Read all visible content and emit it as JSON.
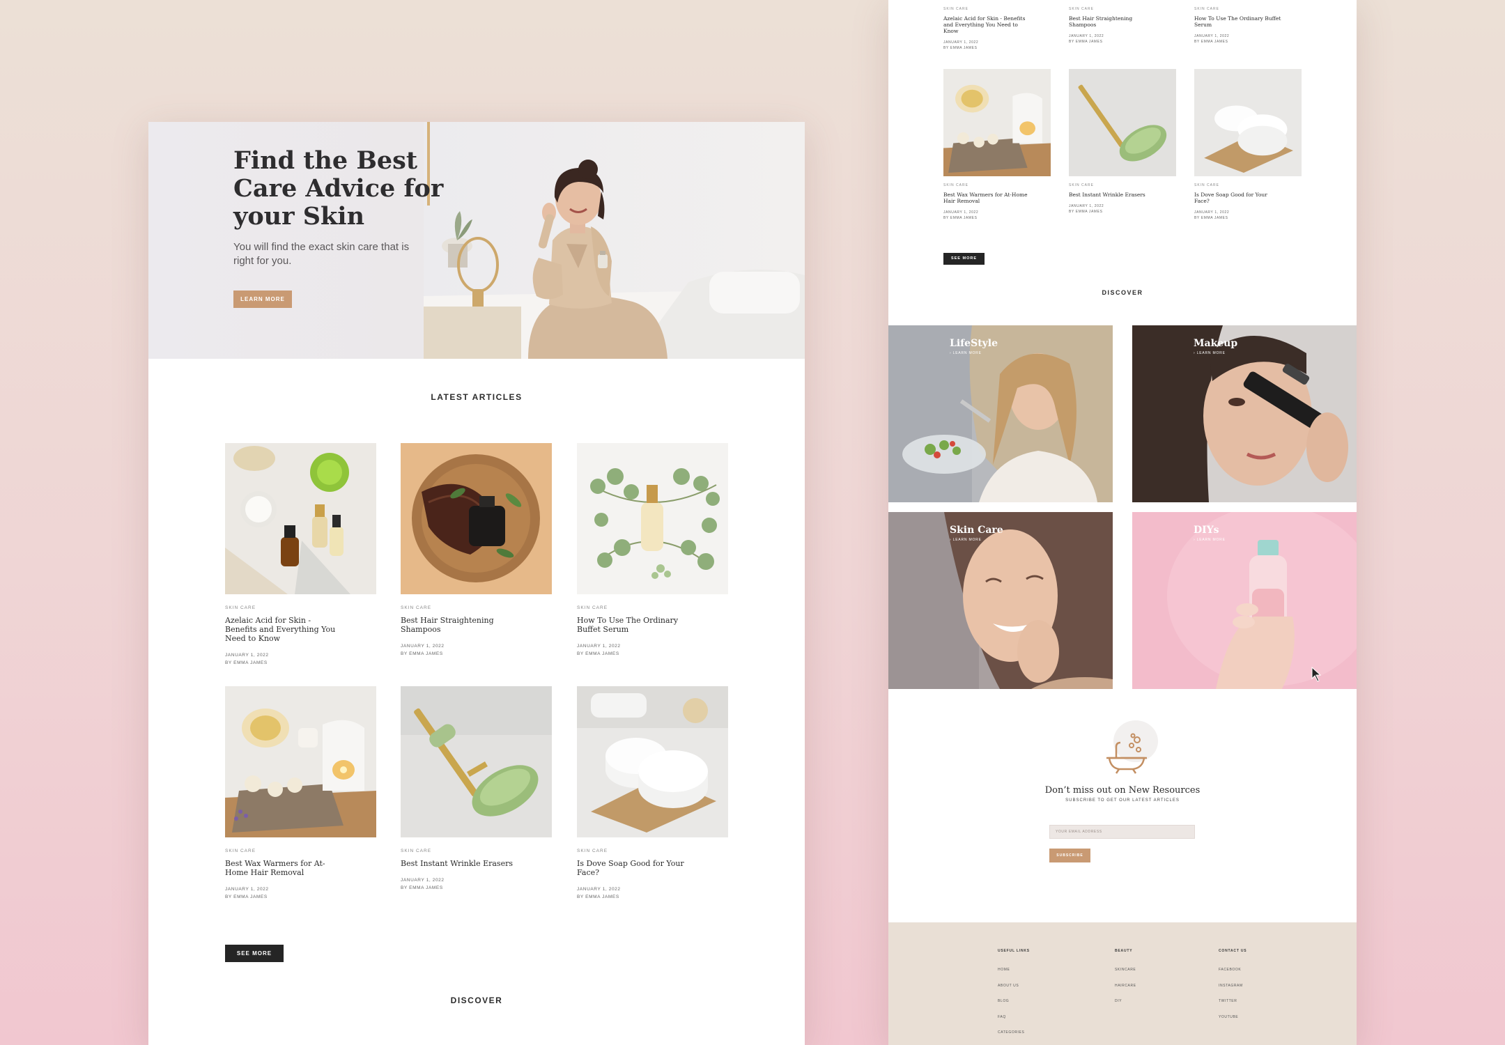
{
  "hero": {
    "title": "Find the Best Care Advice for your Skin",
    "subtitle": "You will find the exact skin care that is right for you.",
    "button_label": "LEARN MORE"
  },
  "latest": {
    "heading": "LATEST ARTICLES"
  },
  "articles": [
    {
      "category": "SKIN CARE",
      "title": "Azelaic Acid for Skin - Benefits and Everything You Need to Know",
      "date": "JANUARY 1, 2022",
      "author": "BY EMMA JAMES"
    },
    {
      "category": "SKIN CARE",
      "title": "Best Hair Straightening Shampoos",
      "date": "JANUARY 1, 2022",
      "author": "BY EMMA JAMES"
    },
    {
      "category": "SKIN CARE",
      "title": "How To Use The Ordinary Buffet Serum",
      "date": "JANUARY 1, 2022",
      "author": "BY EMMA JAMES"
    },
    {
      "category": "SKIN CARE",
      "title": "Best Wax Warmers for At-Home Hair Removal",
      "date": "JANUARY 1, 2022",
      "author": "BY EMMA JAMES"
    },
    {
      "category": "SKIN CARE",
      "title": "Best Instant Wrinkle Erasers",
      "date": "JANUARY 1, 2022",
      "author": "BY EMMA JAMES"
    },
    {
      "category": "SKIN CARE",
      "title": "Is Dove Soap Good for Your Face?",
      "date": "JANUARY 1, 2022",
      "author": "BY EMMA JAMES"
    }
  ],
  "see_more_label": "SEE MORE",
  "discover": {
    "heading": "DISCOVER",
    "tiles": [
      {
        "title": "LifeStyle",
        "link": "› LEARN MORE"
      },
      {
        "title": "Makeup",
        "link": "› LEARN MORE"
      },
      {
        "title": "Skin Care",
        "link": "› LEARN MORE"
      },
      {
        "title": "DIYs",
        "link": "› LEARN MORE"
      }
    ]
  },
  "newsletter": {
    "title": "Don’t miss out on New Resources",
    "subtitle": "SUBSCRIBE TO GET OUR LATEST ARTICLES",
    "placeholder": "YOUR EMAIL ADDRESS",
    "button_label": "SUBSCRIBE"
  },
  "footer": {
    "columns": [
      {
        "heading": "USEFUL LINKS",
        "links": [
          "HOME",
          "ABOUT US",
          "BLOG",
          "FAQ",
          "CATEGORIES"
        ]
      },
      {
        "heading": "BEAUTY",
        "links": [
          "SKINCARE",
          "HAIRCARE",
          "DIY"
        ]
      },
      {
        "heading": "CONTACT US",
        "links": [
          "FACEBOOK",
          "INSTAGRAM",
          "TWITTER",
          "YOUTUBE"
        ]
      }
    ]
  },
  "colors": {
    "accent": "#c99a73",
    "dark_button": "#252525",
    "footer_bg": "#e9dfd5"
  }
}
